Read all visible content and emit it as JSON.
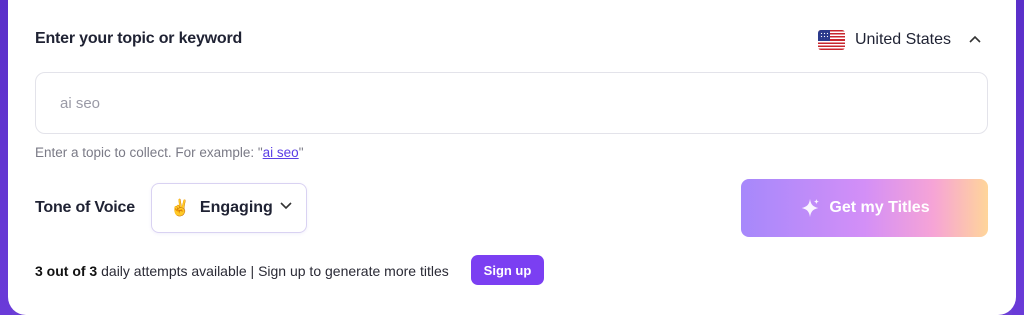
{
  "form": {
    "title": "Enter your topic or keyword",
    "country": {
      "name": "United States",
      "flag_icon": "us-flag-icon",
      "chevron_icon": "chevron-up-icon"
    },
    "topic_input": {
      "value": "",
      "placeholder": "ai seo"
    },
    "hint": {
      "prefix": "Enter a topic to collect. For example: \"",
      "example": "ai seo",
      "suffix": "\""
    },
    "tone": {
      "label": "Tone of Voice",
      "emoji": "✌️",
      "selected": "Engaging",
      "chevron": "⌄"
    },
    "submit": {
      "label": "Get my Titles",
      "icon": "sparkle-icon"
    },
    "attempts": {
      "count": "3 out of 3",
      "text": " daily attempts available | Sign up to generate more titles"
    },
    "signup_label": "Sign up"
  },
  "colors": {
    "accent": "#7b3ff2",
    "frame": "#6c3fd6",
    "link": "#5b3ee6"
  }
}
